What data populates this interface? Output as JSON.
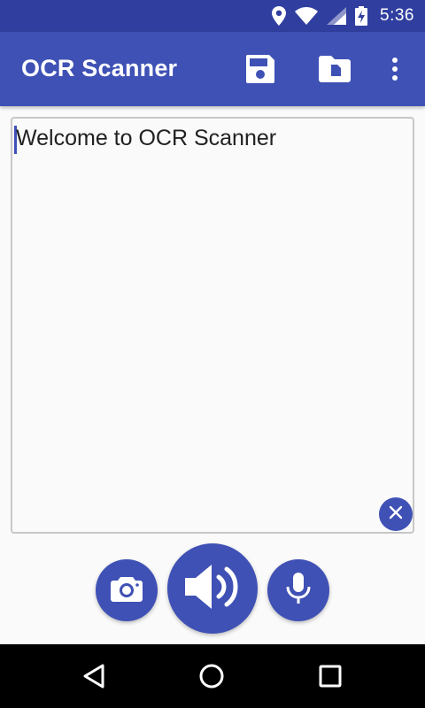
{
  "status_bar": {
    "time": "5:36",
    "icons": [
      "location-icon",
      "wifi-icon",
      "signal-icon",
      "battery-charging-icon"
    ]
  },
  "app_bar": {
    "title": "OCR Scanner",
    "actions": [
      "save-icon",
      "open-file-icon",
      "more-vert-icon"
    ]
  },
  "editor": {
    "text": "Welcome to OCR Scanner",
    "clear_icon": "clear-icon"
  },
  "buttons": {
    "camera_icon": "camera-icon",
    "speak_icon": "volume-up-icon",
    "mic_icon": "mic-icon"
  },
  "nav_bar": {
    "icons": [
      "back-icon",
      "home-icon",
      "recents-icon"
    ]
  },
  "colors": {
    "primary": "#3f51b5",
    "primary_dark": "#303f9f",
    "background": "#fafafa"
  }
}
